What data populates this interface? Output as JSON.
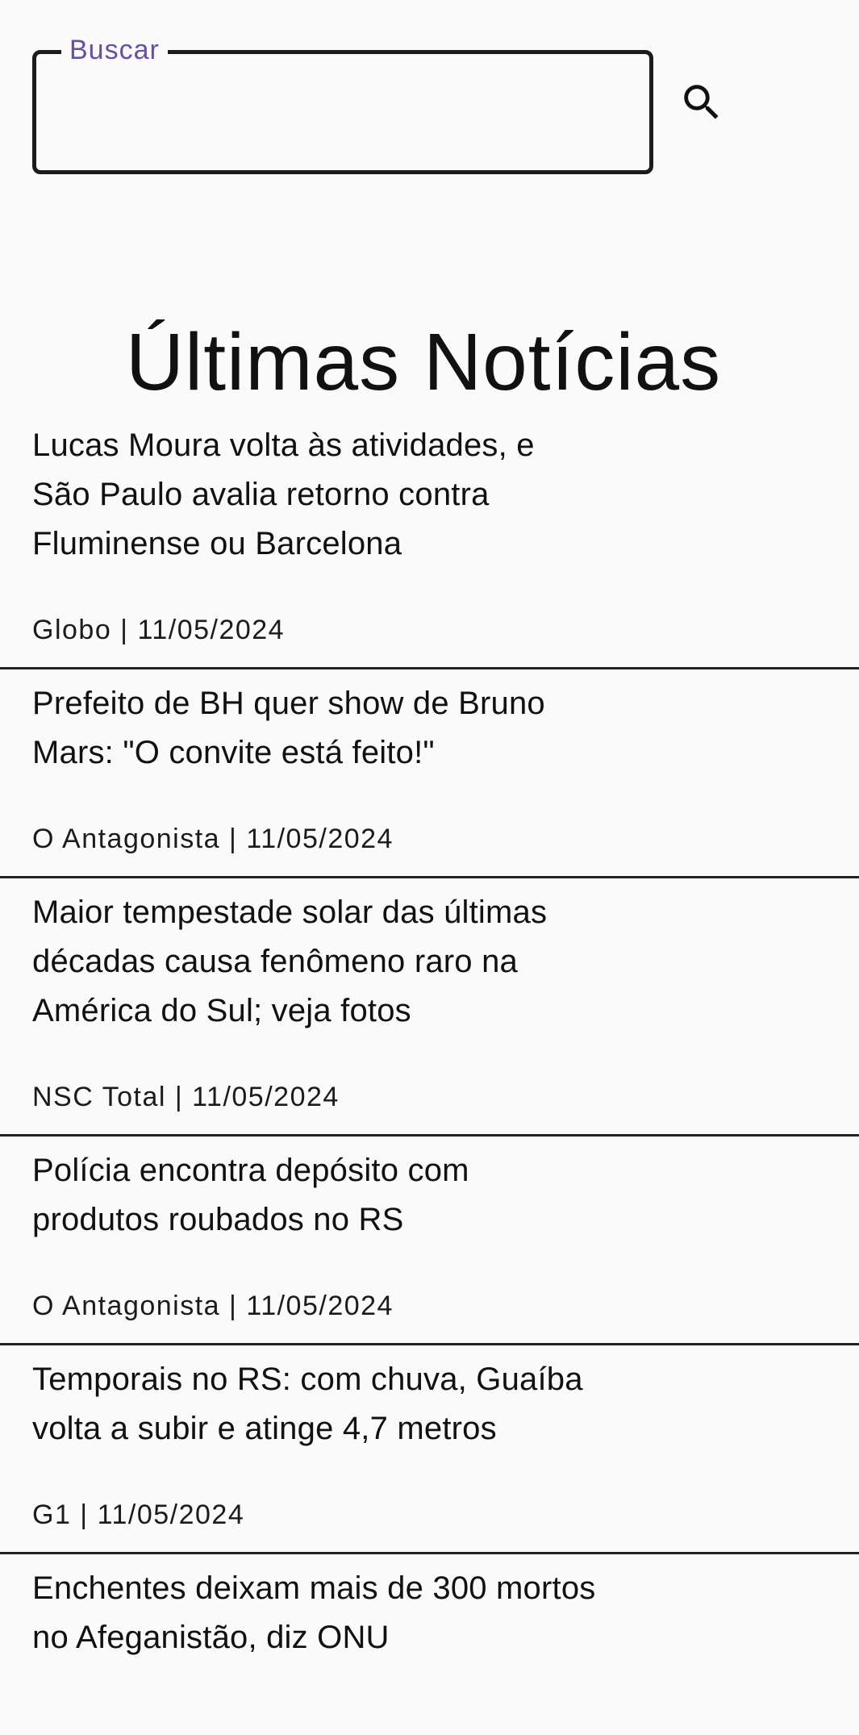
{
  "search": {
    "label": "Buscar",
    "value": "",
    "placeholder": ""
  },
  "icons": {
    "search": "search-icon"
  },
  "colors": {
    "accent": "#6750a4",
    "background": "#fafafa",
    "text": "#1b1b1f"
  },
  "page": {
    "title": "Últimas Notícias"
  },
  "news": [
    {
      "headline": "Lucas Moura volta às atividades, e São Paulo avalia retorno contra Fluminense ou Barcelona",
      "meta": "Globo | 11/05/2024"
    },
    {
      "headline": "Prefeito de BH quer show de Bruno Mars: \"O convite está feito!\"",
      "meta": "O Antagonista | 11/05/2024"
    },
    {
      "headline": "Maior tempestade solar das últimas décadas causa fenômeno raro na América do Sul; veja fotos",
      "meta": "NSC Total | 11/05/2024"
    },
    {
      "headline": "Polícia encontra depósito com produtos roubados no RS",
      "meta": "O Antagonista | 11/05/2024"
    },
    {
      "headline": "Temporais no RS: com chuva, Guaíba volta a subir e atinge 4,7 metros",
      "meta": "G1 | 11/05/2024"
    },
    {
      "headline": "Enchentes deixam mais de 300 mortos no Afeganistão, diz ONU",
      "meta": ""
    }
  ]
}
